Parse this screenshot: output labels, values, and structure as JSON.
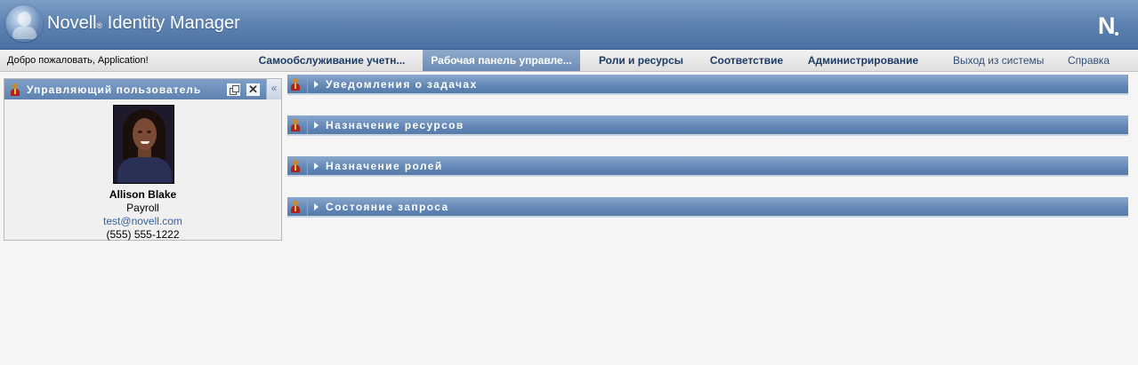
{
  "header": {
    "product_name": "Novell",
    "registered_mark": "®",
    "product_title": " Identity Manager",
    "corner_logo": "N"
  },
  "navbar": {
    "welcome": "Добро пожаловать, Application!",
    "tabs": [
      {
        "label": "Самообслуживание учетн...",
        "active": false
      },
      {
        "label": "Рабочая панель управле...",
        "active": true
      },
      {
        "label": "Роли и ресурсы",
        "active": false
      },
      {
        "label": "Соответствие",
        "active": false
      },
      {
        "label": "Администрирование",
        "active": false
      }
    ],
    "logout": "Выход из системы",
    "help": "Справка"
  },
  "portlet": {
    "title": "Управляющий пользователь",
    "collapse_glyph": "«",
    "close_glyph": "✕",
    "person": {
      "name": "Allison Blake",
      "department": "Payroll",
      "email": "test@novell.com",
      "phone": "(555) 555-1222"
    }
  },
  "sections": [
    {
      "label": "Уведомления о задачах"
    },
    {
      "label": "Назначение ресурсов"
    },
    {
      "label": "Назначение ролей"
    },
    {
      "label": "Состояние запроса"
    }
  ],
  "colors": {
    "banner": "#5f84b2",
    "active_tab": "#6e8db5",
    "section_bar": "#6287b6",
    "link": "#2f62a8"
  }
}
